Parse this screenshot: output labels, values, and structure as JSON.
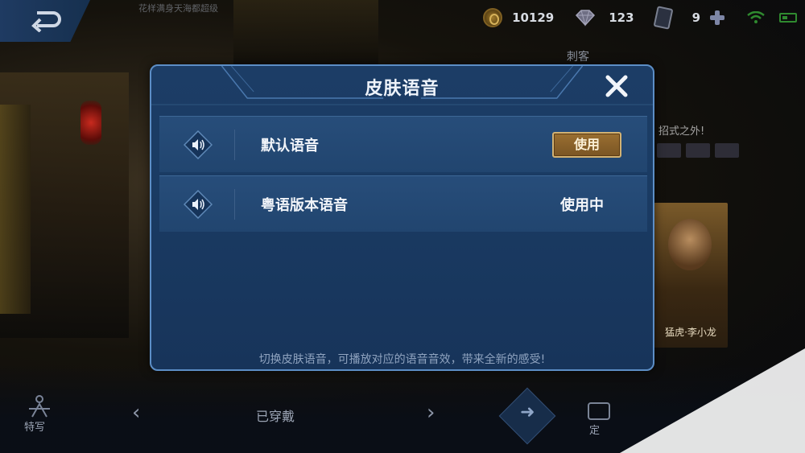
{
  "background": {
    "top_label": "花样满身天海都超级",
    "right_label": "刺客",
    "right_text": "招式之外!",
    "poster_text": "猛虎·李小龙"
  },
  "topbar": {
    "gold": "10129",
    "gems": "123",
    "cards": "9"
  },
  "dialog": {
    "title": "皮肤语音",
    "rows": [
      {
        "label": "默认语音",
        "action": "使用"
      },
      {
        "label": "粤语版本语音",
        "status": "使用中"
      }
    ],
    "footer": "切换皮肤语音，可播放对应的语音音效，带来全新的感受!"
  },
  "bottombar": {
    "feature_label": "特写",
    "equipped": "已穿戴",
    "camera_label": "定"
  },
  "colors": {
    "dialog_bg": "#1b3c64",
    "dialog_border": "#5c8ec6",
    "use_button": "#8a6229",
    "use_button_border": "#d3b272"
  },
  "icons": [
    "back-arrow-icon",
    "gold-coin-icon",
    "gem-icon",
    "card-icon",
    "plus-icon",
    "wifi-icon",
    "battery-icon",
    "close-icon",
    "speaker-icon",
    "chevron-left-icon",
    "chevron-right-icon",
    "camera-icon"
  ]
}
